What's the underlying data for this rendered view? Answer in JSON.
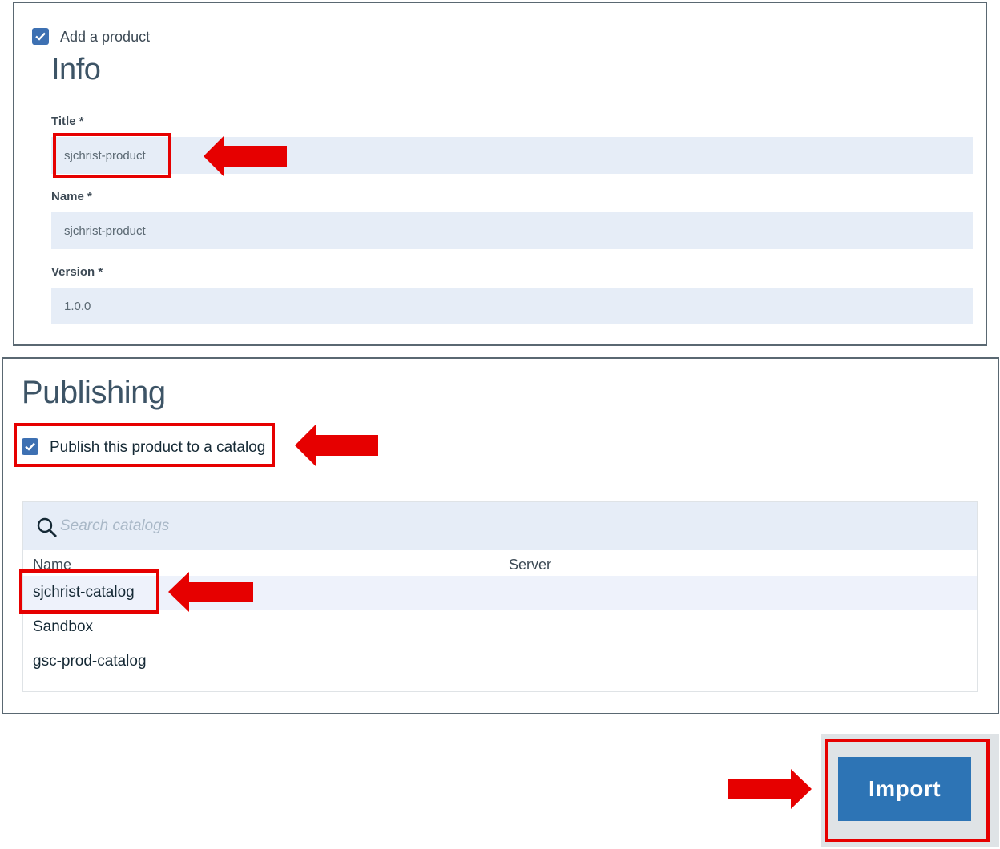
{
  "info": {
    "add_product_label": "Add a product",
    "add_product_checked": true,
    "section_title": "Info",
    "fields": {
      "title": {
        "label": "Title *",
        "value": "sjchrist-product"
      },
      "name": {
        "label": "Name *",
        "value": "sjchrist-product"
      },
      "version": {
        "label": "Version *",
        "value": "1.0.0"
      }
    }
  },
  "publishing": {
    "section_title": "Publishing",
    "publish_checkbox_label": "Publish this product to a catalog",
    "publish_checked": true,
    "search": {
      "placeholder": "Search catalogs"
    },
    "columns": [
      "Name",
      "Server"
    ],
    "catalogs": [
      {
        "name": "sjchrist-catalog",
        "server": "",
        "selected": true
      },
      {
        "name": "Sandbox",
        "server": "",
        "selected": false
      },
      {
        "name": "gsc-prod-catalog",
        "server": "",
        "selected": false
      }
    ]
  },
  "actions": {
    "import_label": "Import"
  },
  "colors": {
    "highlight": "#e60000",
    "primary": "#2d74b5",
    "checkbox": "#3d70b2",
    "input_bg": "#e6edf7"
  },
  "icons": {
    "checkbox": "checkmark-icon",
    "search": "search-icon",
    "annotation": "red-arrow-icon"
  }
}
